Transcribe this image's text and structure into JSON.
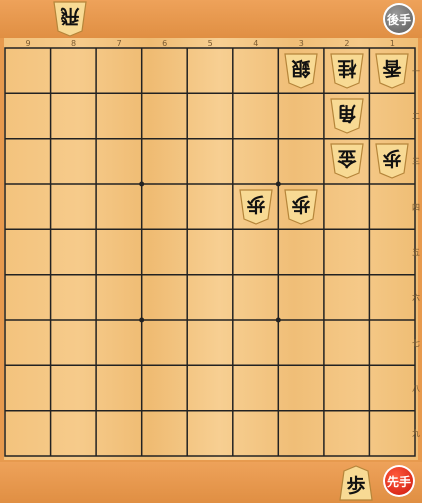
{
  "board": {
    "files": [
      "9",
      "8",
      "7",
      "6",
      "5",
      "4",
      "3",
      "2",
      "1"
    ],
    "ranks": [
      "一",
      "二",
      "三",
      "四",
      "五",
      "六",
      "七",
      "八",
      "九"
    ]
  },
  "gote_hand": {
    "badge": "後手",
    "pieces": [
      "飛"
    ]
  },
  "sente_hand": {
    "badge": "先手",
    "pieces": [
      "歩"
    ]
  },
  "pieces": [
    {
      "label": "銀",
      "side": "gote",
      "file": 3,
      "rank": 1
    },
    {
      "label": "桂",
      "side": "gote",
      "file": 2,
      "rank": 1
    },
    {
      "label": "香",
      "side": "gote",
      "file": 1,
      "rank": 1
    },
    {
      "label": "角",
      "side": "gote",
      "file": 2,
      "rank": 2
    },
    {
      "label": "金",
      "side": "gote",
      "file": 2,
      "rank": 3
    },
    {
      "label": "歩",
      "side": "gote",
      "file": 1,
      "rank": 3
    },
    {
      "label": "歩",
      "side": "gote",
      "file": 4,
      "rank": 4
    },
    {
      "label": "歩",
      "side": "gote",
      "file": 3,
      "rank": 4
    }
  ],
  "colors": {
    "board": "#f3c37d",
    "hand_area": "#e79a4e",
    "sente_badge": "#d8170f",
    "gote_badge": "#707070"
  }
}
